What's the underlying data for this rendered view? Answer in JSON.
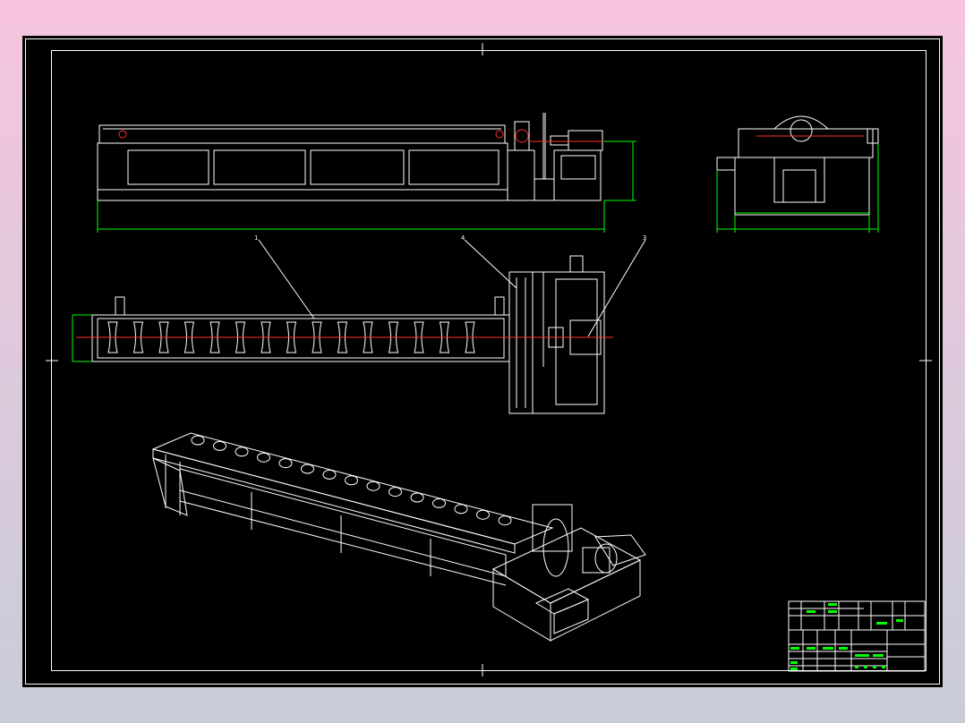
{
  "colors": {
    "background_top": "#f7c4de",
    "background_bottom": "#c8ccd8",
    "canvas": "#000000",
    "line": "#ffffff",
    "dimension": "#00ff00",
    "centerline": "#ff3030",
    "title_block_text": "#00ff00"
  },
  "drawing": {
    "views": [
      "front-view",
      "side-view",
      "top-view",
      "isometric-view"
    ],
    "balloons": [
      "1",
      "4",
      "3"
    ],
    "roller_count": 15
  }
}
